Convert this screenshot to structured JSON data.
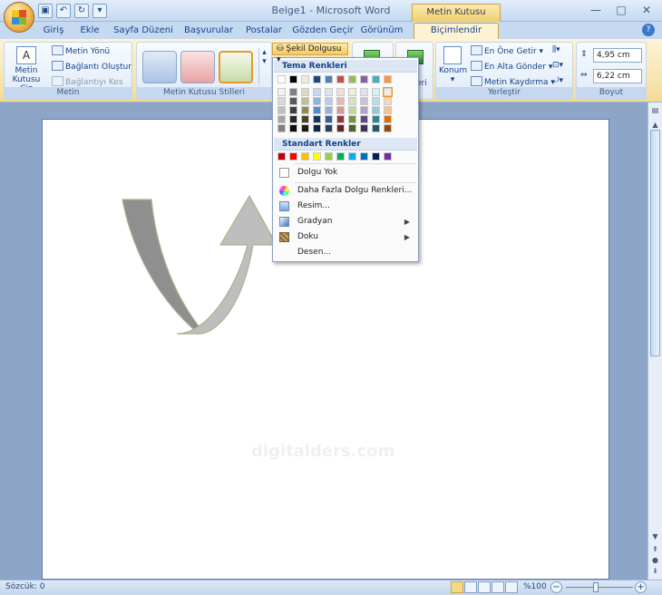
{
  "window": {
    "title": "Belge1 - Microsoft Word",
    "contextual_group": "Metin Kutusu Araçları"
  },
  "tabs": [
    {
      "label": "Giriş"
    },
    {
      "label": "Ekle"
    },
    {
      "label": "Sayfa Düzeni"
    },
    {
      "label": "Başvurular"
    },
    {
      "label": "Postalar"
    },
    {
      "label": "Gözden Geçir"
    },
    {
      "label": "Görünüm"
    },
    {
      "label": "Biçimlendir"
    }
  ],
  "ribbon": {
    "metin": {
      "label": "Metin",
      "draw_textbox": "Metin Kutusu Çiz",
      "direction": "Metin Yönü",
      "create_link": "Bağlantı Oluştur",
      "break_link": "Bağlantıyı Kes"
    },
    "styles": {
      "label": "Metin Kutusu Stilleri"
    },
    "shape_fill": "Şekil Dolgusu",
    "hidden_group_fragment": "eri",
    "arrange": {
      "label": "Yerleştir",
      "position": "Konum",
      "bring_front": "En Öne Getir",
      "send_back": "En Alta Gönder",
      "text_wrap": "Metin Kaydırma"
    },
    "size": {
      "label": "Boyut",
      "height": "4,95 cm",
      "width": "6,22 cm"
    }
  },
  "dropdown": {
    "theme_colors_header": "Tema Renkleri",
    "standard_colors_header": "Standart Renkler",
    "no_fill": "Dolgu Yok",
    "more_colors": "Daha Fazla Dolgu Renkleri...",
    "picture": "Resim...",
    "gradient": "Gradyan",
    "texture": "Doku",
    "pattern": "Desen...",
    "theme_top_row": [
      "#ffffff",
      "#000000",
      "#eeece1",
      "#1f497d",
      "#4f81bd",
      "#c0504d",
      "#9bbb59",
      "#8064a2",
      "#4bacc6",
      "#f79646"
    ],
    "theme_columns": [
      [
        "#f2f2f2",
        "#d8d8d8",
        "#bfbfbf",
        "#a5a5a5",
        "#7f7f7f"
      ],
      [
        "#7f7f7f",
        "#595959",
        "#3f3f3f",
        "#262626",
        "#0c0c0c"
      ],
      [
        "#ddd9c3",
        "#c4bd97",
        "#938953",
        "#494429",
        "#1d1b10"
      ],
      [
        "#c6d9f0",
        "#8db3e2",
        "#548dd4",
        "#17365d",
        "#0f243e"
      ],
      [
        "#dbe5f1",
        "#b8cce4",
        "#95b3d7",
        "#366092",
        "#244061"
      ],
      [
        "#f2dcdb",
        "#e5b9b7",
        "#d99694",
        "#953734",
        "#632423"
      ],
      [
        "#ebf1dd",
        "#d7e3bc",
        "#c3d69b",
        "#76923c",
        "#4f6128"
      ],
      [
        "#e5e0ec",
        "#ccc1d9",
        "#b2a2c7",
        "#5f497a",
        "#3f3151"
      ],
      [
        "#dbeef3",
        "#b7dde8",
        "#92cddc",
        "#31859b",
        "#205867"
      ],
      [
        "#fdeada",
        "#fbd5b5",
        "#fac08f",
        "#e36c09",
        "#974806"
      ]
    ],
    "standard_row": [
      "#c00000",
      "#ff0000",
      "#ffc000",
      "#ffff00",
      "#92d050",
      "#00b050",
      "#00b0f0",
      "#0070c0",
      "#002060",
      "#7030a0"
    ]
  },
  "document": {
    "watermark": "digitalders.com"
  },
  "status": {
    "words": "Sözcük: 0",
    "zoom": "%100"
  },
  "colors": {
    "accent_active": "#f7c95f",
    "ribbon_blue": "#c5d9f1",
    "arrow_fill": "#a9a9a9"
  }
}
